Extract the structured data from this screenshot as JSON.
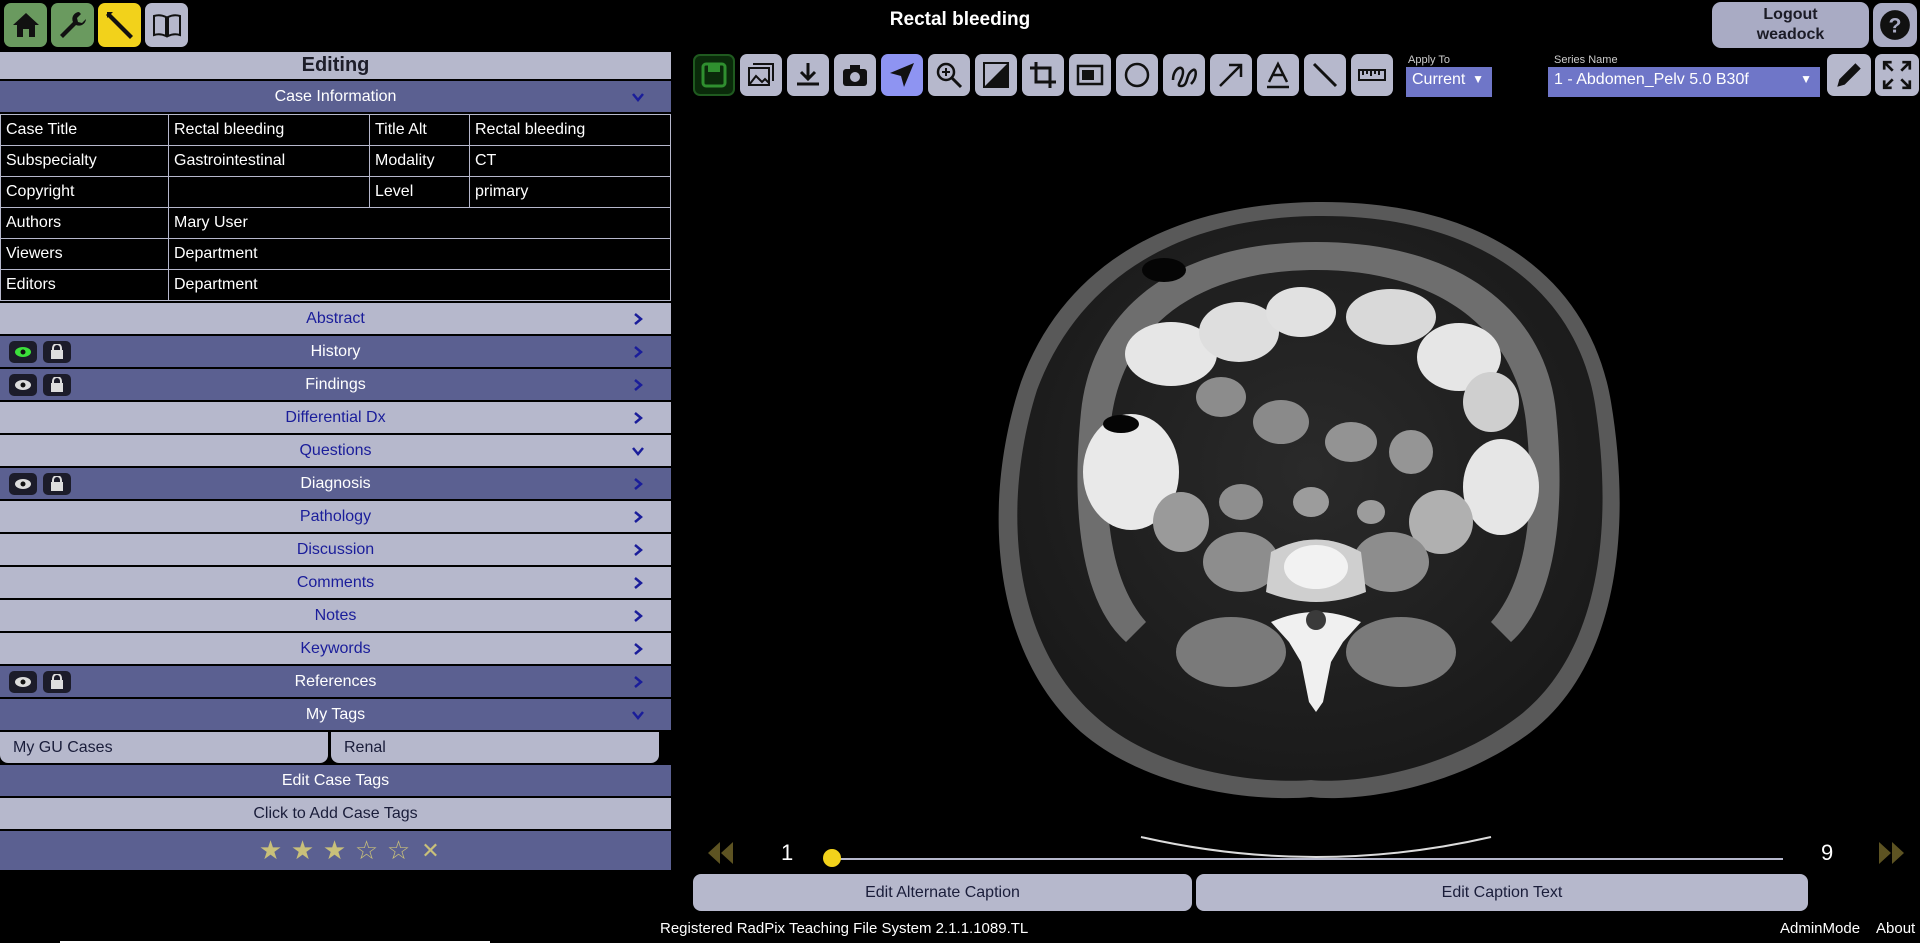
{
  "header": {
    "title": "Rectal bleeding",
    "logout_label_line1": "Logout",
    "logout_label_line2": "weadock",
    "nav_icons": [
      "home-icon",
      "wrench-icon",
      "edit-icon",
      "book-icon"
    ]
  },
  "panel": {
    "title": "Editing",
    "case_info_label": "Case Information",
    "case_info": {
      "case_title_label": "Case Title",
      "case_title": "Rectal bleeding",
      "title_alt_label": "Title Alt",
      "title_alt": "Rectal bleeding",
      "subspecialty_label": "Subspecialty",
      "subspecialty": "Gastrointestinal",
      "modality_label": "Modality",
      "modality": "CT",
      "copyright_label": "Copyright",
      "copyright": "",
      "level_label": "Level",
      "level": "primary",
      "authors_label": "Authors",
      "authors": "Mary User",
      "viewers_label": "Viewers",
      "viewers": "Department",
      "editors_label": "Editors",
      "editors": "Department"
    },
    "sections": {
      "abstract": "Abstract",
      "history": "History",
      "findings": "Findings",
      "differential": "Differential Dx",
      "questions": "Questions",
      "diagnosis": "Diagnosis",
      "pathology": "Pathology",
      "discussion": "Discussion",
      "comments": "Comments",
      "notes": "Notes",
      "keywords": "Keywords",
      "references": "References",
      "my_tags": "My Tags"
    },
    "tags": [
      "My GU Cases",
      "Renal"
    ],
    "edit_tags_label": "Edit Case Tags",
    "add_tags_label": "Click to Add Case Tags",
    "rating": {
      "filled": 3,
      "max": 5
    }
  },
  "viewer": {
    "apply_to_label": "Apply To",
    "apply_to_value": "Current",
    "series_label": "Series Name",
    "series_value": "1 - Abdomen_Pelv 5.0 B30f",
    "slice_current": "1",
    "slice_total": "9",
    "slice_progress": 0.0,
    "edit_alt_caption": "Edit Alternate Caption",
    "edit_caption": "Edit Caption Text",
    "tools": [
      "save-icon",
      "gallery-icon",
      "download-icon",
      "camera-icon",
      "pointer-icon",
      "zoom-icon",
      "window-level-icon",
      "crop-icon",
      "rectangle-icon",
      "circle-icon",
      "freehand-icon",
      "arrow-icon",
      "text-icon",
      "line-icon",
      "ruler-icon"
    ]
  },
  "footer": {
    "system": "Registered RadPix Teaching File System 2.1.1.1089.TL",
    "admin": "AdminMode",
    "about": "About"
  },
  "colors": {
    "light_section": "#b6b8cc",
    "dark_section": "#5b6091",
    "accent_yellow": "#f2d21b",
    "nav_green": "#6a9a5f",
    "select_blue": "#6f76c8"
  }
}
